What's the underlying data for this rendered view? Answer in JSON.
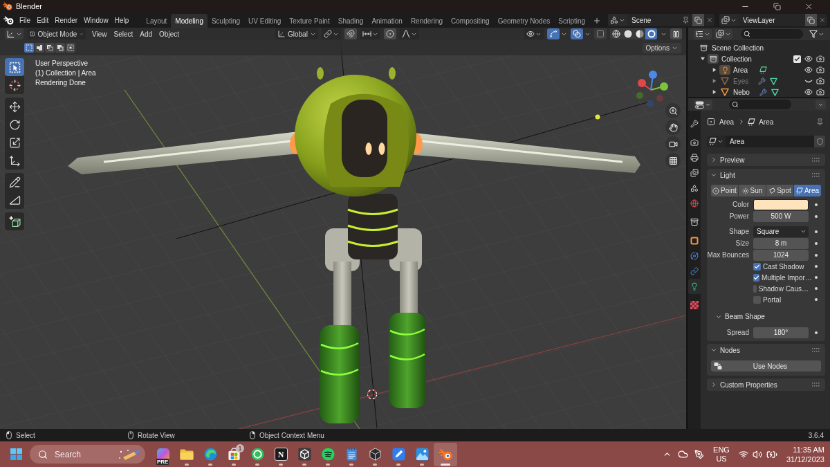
{
  "window": {
    "title": "Blender"
  },
  "menu": [
    "File",
    "Edit",
    "Render",
    "Window",
    "Help"
  ],
  "workspaces": [
    {
      "label": "Layout",
      "selected": false
    },
    {
      "label": "Modeling",
      "selected": true
    },
    {
      "label": "Sculpting",
      "selected": false
    },
    {
      "label": "UV Editing",
      "selected": false
    },
    {
      "label": "Texture Paint",
      "selected": false
    },
    {
      "label": "Shading",
      "selected": false
    },
    {
      "label": "Animation",
      "selected": false
    },
    {
      "label": "Rendering",
      "selected": false
    },
    {
      "label": "Compositing",
      "selected": false
    },
    {
      "label": "Geometry Nodes",
      "selected": false
    },
    {
      "label": "Scripting",
      "selected": false
    }
  ],
  "scene": "Scene",
  "view_layer": "ViewLayer",
  "viewport": {
    "mode": "Object Mode",
    "menus": [
      "View",
      "Select",
      "Add",
      "Object"
    ],
    "orientation": "Global",
    "toggles": [
      {
        "kind": "gizmos",
        "on": true
      },
      {
        "kind": "overlays",
        "on": true
      },
      {
        "kind": "xray",
        "on": false
      }
    ],
    "shading_modes": [
      {
        "kind": "wireframe",
        "selected": false
      },
      {
        "kind": "solid",
        "selected": false
      },
      {
        "kind": "material",
        "selected": false
      },
      {
        "kind": "rendered",
        "selected": true
      }
    ],
    "select_modes": [
      {
        "kind": "set",
        "selected": true
      },
      {
        "kind": "extend",
        "selected": false
      },
      {
        "kind": "subtract",
        "selected": false
      },
      {
        "kind": "invert",
        "selected": false
      },
      {
        "kind": "intersect",
        "selected": false
      }
    ],
    "tool_groups": [
      [
        {
          "kind": "select_box",
          "selected": true
        },
        {
          "kind": "cursor",
          "selected": false
        }
      ],
      [
        {
          "kind": "move",
          "selected": false
        },
        {
          "kind": "rotate",
          "selected": false
        },
        {
          "kind": "scale",
          "selected": false
        },
        {
          "kind": "transform",
          "selected": false
        }
      ],
      [
        {
          "kind": "annotate",
          "selected": false
        },
        {
          "kind": "measure",
          "selected": false
        }
      ],
      [
        {
          "kind": "add_cube",
          "selected": false
        }
      ]
    ],
    "info": [
      "User Perspective",
      "(1) Collection | Area",
      "Rendering Done"
    ],
    "options": "Options"
  },
  "outliner": {
    "items": [
      {
        "name": "Scene Collection",
        "kind": "scene_collection",
        "children": [
          {
            "name": "Collection",
            "kind": "collection",
            "expanded": true,
            "checked": true,
            "visible": true,
            "children": [
              {
                "name": "Area",
                "kind": "light",
                "expanded": false,
                "visible": true
              },
              {
                "name": "Eyes",
                "kind": "mesh",
                "expanded": false,
                "visible": false
              },
              {
                "name": "Nebo",
                "kind": "mesh",
                "expanded": false,
                "visible": true
              }
            ]
          }
        ]
      }
    ]
  },
  "properties": {
    "tab_groups": [
      [
        {
          "kind": "tool",
          "selected": false
        }
      ],
      [
        {
          "kind": "render",
          "selected": false
        },
        {
          "kind": "output",
          "selected": false
        },
        {
          "kind": "view_layer",
          "selected": false
        },
        {
          "kind": "scene",
          "selected": false
        },
        {
          "kind": "world",
          "selected": false
        }
      ],
      [
        {
          "kind": "collection",
          "selected": false
        }
      ],
      [
        {
          "kind": "object",
          "selected": false
        },
        {
          "kind": "physics",
          "selected": false
        },
        {
          "kind": "constraints",
          "selected": false
        },
        {
          "kind": "light_data",
          "selected": true
        }
      ],
      [
        {
          "kind": "texture",
          "selected": false
        }
      ]
    ],
    "breadcrumb": [
      "Area",
      "Area"
    ],
    "datablock": "Area",
    "panels": [
      {
        "title": "Preview",
        "expanded": false
      },
      {
        "title": "Light",
        "expanded": true,
        "light_types": [
          {
            "kind": "point",
            "label": "Point",
            "selected": false
          },
          {
            "kind": "sun",
            "label": "Sun",
            "selected": false
          },
          {
            "kind": "spot",
            "label": "Spot",
            "selected": false
          },
          {
            "kind": "area",
            "label": "Area",
            "selected": true
          }
        ],
        "rows": [
          {
            "kind": "color",
            "label": "Color",
            "color": "#fee3bd"
          },
          {
            "kind": "number",
            "label": "Power",
            "value": "500 W"
          },
          {
            "kind": "dropdown",
            "label": "Shape",
            "value": "Square"
          },
          {
            "kind": "number",
            "label": "Size",
            "value": "8 m"
          },
          {
            "kind": "number",
            "label": "Max Bounces",
            "value": "1024"
          },
          {
            "kind": "checkbox",
            "label": "Cast Shadow",
            "checked": true
          },
          {
            "kind": "checkbox",
            "label": "Multiple Impor…",
            "checked": true
          },
          {
            "kind": "checkbox",
            "label": "Shadow Caus…",
            "checked": false
          },
          {
            "kind": "checkbox",
            "label": "Portal",
            "checked": false
          }
        ],
        "subpanels": [
          {
            "title": "Beam Shape",
            "expanded": true,
            "rows": [
              {
                "kind": "number",
                "label": "Spread",
                "value": "180°"
              }
            ]
          }
        ]
      },
      {
        "title": "Nodes",
        "expanded": true,
        "button": "Use Nodes"
      },
      {
        "title": "Custom Properties",
        "expanded": false
      }
    ]
  },
  "status_bar": {
    "hints": [
      {
        "kind": "left_click",
        "label": "Select"
      },
      {
        "kind": "middle_click",
        "label": "Rotate View"
      },
      {
        "kind": "right_click",
        "label": "Object Context Menu"
      }
    ],
    "version": "3.6.4"
  },
  "taskbar": {
    "search": {
      "placeholder": "Search"
    },
    "apps": [
      {
        "kind": "copilot",
        "label": "PRE",
        "running": false,
        "selected": false
      },
      {
        "kind": "folder",
        "running": true,
        "selected": false
      },
      {
        "kind": "browser",
        "running": true,
        "selected": false
      },
      {
        "kind": "store",
        "badge": "1",
        "running": true,
        "selected": false
      },
      {
        "kind": "chat",
        "running": true,
        "selected": false
      },
      {
        "kind": "notion",
        "label": "N",
        "running": true,
        "selected": false
      },
      {
        "kind": "unity",
        "running": true,
        "selected": false
      },
      {
        "kind": "spotify",
        "running": true,
        "selected": false
      },
      {
        "kind": "notepad",
        "running": true,
        "selected": false
      },
      {
        "kind": "unity_hub",
        "running": true,
        "selected": false
      },
      {
        "kind": "pen",
        "running": true,
        "selected": false
      },
      {
        "kind": "photos",
        "running": true,
        "selected": false
      },
      {
        "kind": "blender",
        "running": true,
        "selected": true
      }
    ],
    "tray": {
      "language": [
        "ENG",
        "US"
      ],
      "time": "11:35 AM",
      "date": "31/12/2023"
    }
  }
}
